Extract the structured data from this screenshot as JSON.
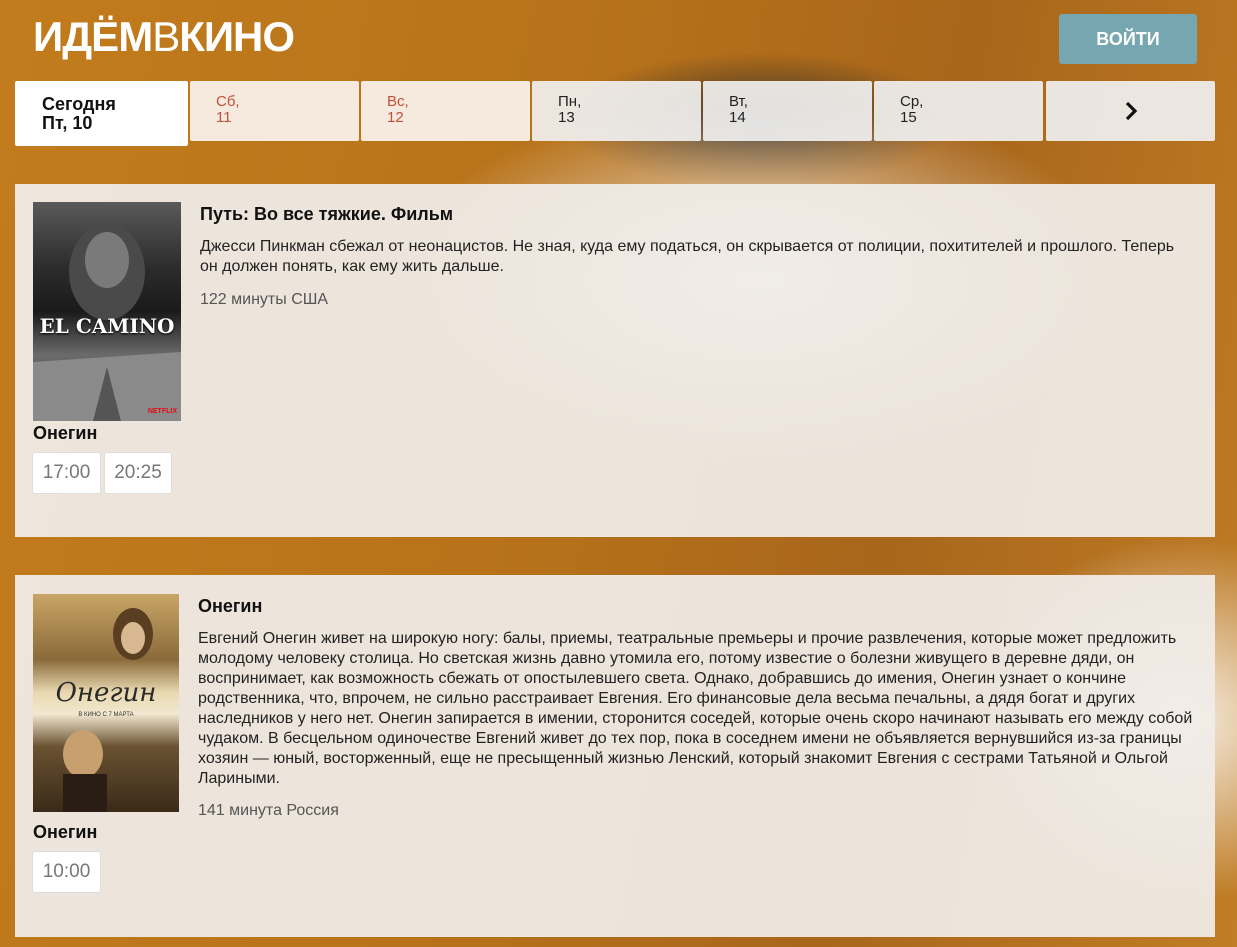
{
  "header": {
    "logo_part1": "ИДЁМ",
    "logo_part2": "В",
    "logo_part3": "КИНО",
    "login_label": "ВОЙТИ"
  },
  "days": [
    {
      "line1": "Сегодня",
      "line2": "Пт, 10",
      "state": "today"
    },
    {
      "line1": "Сб,",
      "line2": "11",
      "state": "weekend"
    },
    {
      "line1": "Вс,",
      "line2": "12",
      "state": "weekend"
    },
    {
      "line1": "Пн,",
      "line2": "13",
      "state": "normal"
    },
    {
      "line1": "Вт,",
      "line2": "14",
      "state": "normal"
    },
    {
      "line1": "Ср,",
      "line2": "15",
      "state": "normal"
    }
  ],
  "next_arrow": "›",
  "movies": [
    {
      "title": "Путь: Во все тяжкие. Фильм",
      "description": "Джесси Пинкман сбежал от неонацистов. Не зная, куда ему податься, он скрывается от полиции, похитителей и прошлого. Теперь он должен понять, как ему жить дальше.",
      "meta": "122 минуты США",
      "poster_text": "EL CAMINO",
      "poster_badge": "NETFLIX",
      "hall": "Онегин",
      "times": [
        "17:00",
        "20:25"
      ]
    },
    {
      "title": "Онегин",
      "description": "Евгений Онегин живет на широкую ногу: балы, приемы, театральные премьеры и прочие развлечения, которые может предложить молодому человеку столица. Но светская жизнь давно утомила его, потому известие о болезни живущего в деревне дяди, он воспринимает, как возможность сбежать от опостылевшего света. Однако, добравшись до имения, Онегин узнает о кончине родственника, что, впрочем, не сильно расстраивает Евгения. Его финансовые дела весьма печальны, а дядя богат и других наследников у него нет. Онегин запирается в имении, сторонится соседей, которые очень скоро начинают называть его между собой чудаком. В бесцельном одиночестве Евгений живет до тех пор, пока в соседнем имени не объявляется вернувшийся из-за границы хозяин — юный, восторженный, еще не пресыщенный жизнью Ленский, который знакомит Евгения с сестрами Татьяной и Ольгой Лариными.",
      "meta": "141 минута Россия",
      "poster_text": "Онегин",
      "poster_badge": "В КИНО С 7 МАРТА",
      "hall": "Онегин",
      "times": [
        "10:00"
      ]
    }
  ]
}
